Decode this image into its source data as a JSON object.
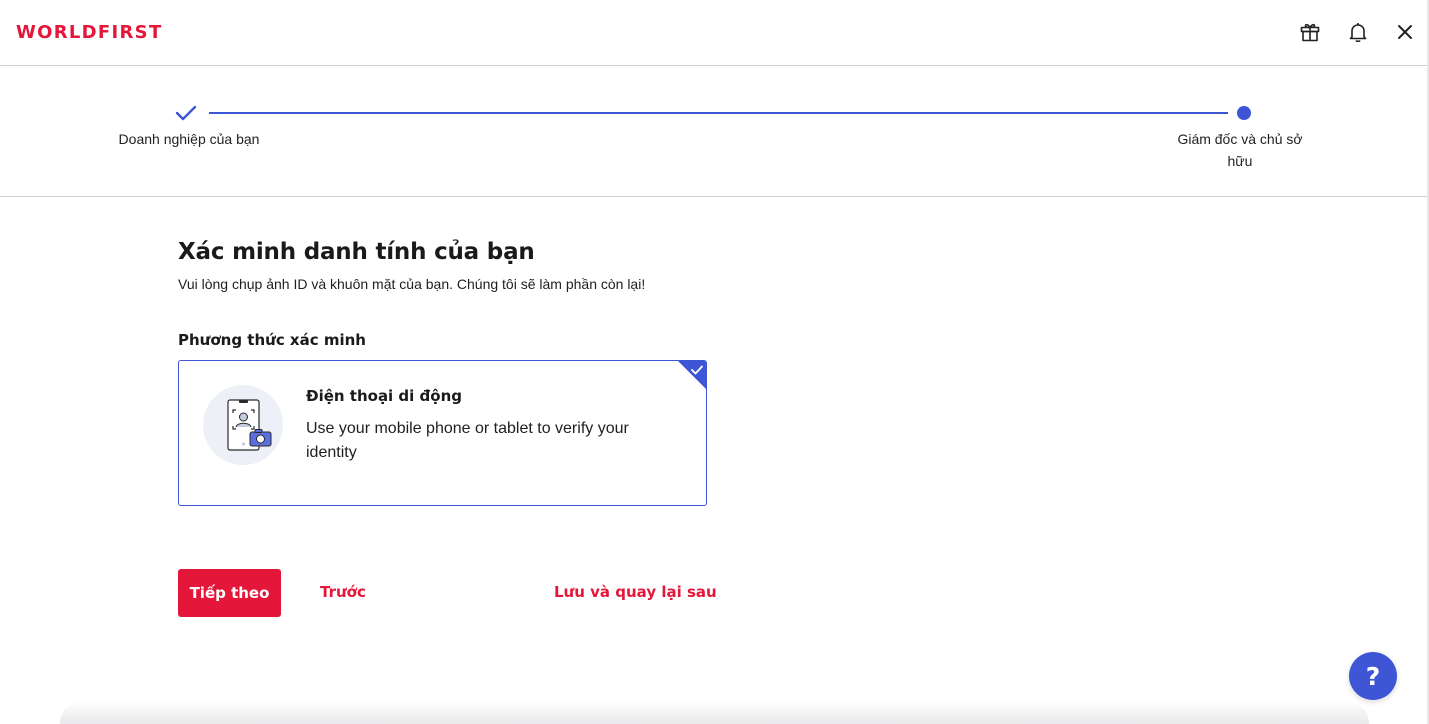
{
  "brand": {
    "logo_text": "WORLDFIRST",
    "color": "#e4173b"
  },
  "header": {
    "icons": [
      "gift-icon",
      "bell-icon",
      "close-icon"
    ]
  },
  "stepper": {
    "accent": "#3e55d6",
    "steps": [
      {
        "label": "Doanh nghiệp của bạn",
        "status": "completed"
      },
      {
        "label": "Giám đốc và chủ sở hữu",
        "status": "current"
      }
    ]
  },
  "main": {
    "title": "Xác minh danh tính của bạn",
    "subtitle": "Vui lòng chụp ảnh ID và khuôn mặt của bạn. Chúng tôi sẽ làm phần còn lại!",
    "method_label": "Phương thức xác minh",
    "method_card": {
      "title": "Điện thoại di động",
      "description": "Use your mobile phone or tablet to verify your identity",
      "selected": true,
      "icon": "mobile-face-scan-icon"
    }
  },
  "actions": {
    "next_label": "Tiếp theo",
    "back_label": "Trước",
    "save_label": "Lưu và quay lại sau"
  },
  "help": {
    "label": "?",
    "color": "#3e55d6"
  }
}
